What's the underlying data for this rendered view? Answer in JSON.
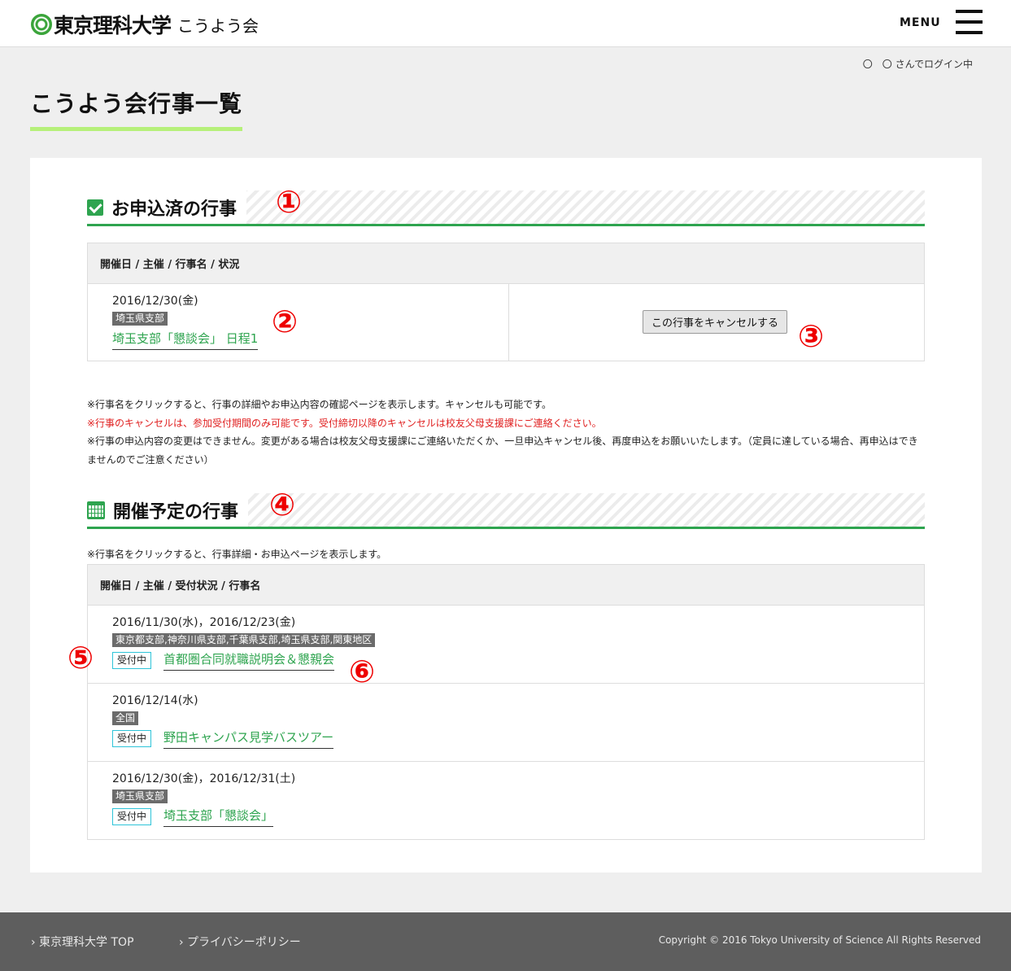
{
  "header": {
    "logo_main": "東京理科大学",
    "logo_sub": "こうよう会",
    "menu_label": "MENU"
  },
  "login_status": "〇　〇 さんでログイン中",
  "page_title": "こうよう会行事一覧",
  "applied": {
    "title": "お申込済の行事",
    "callout": "①",
    "table_header": "開催日 / 主催 / 行事名 / 状況",
    "rows": [
      {
        "date": "2016/12/30(金)",
        "branch": "埼玉県支部",
        "event": "埼玉支部「懇談会」 日程1",
        "cancel_label": "この行事をキャンセルする",
        "callout_event": "②",
        "callout_cancel": "③"
      }
    ]
  },
  "notes": {
    "line1": "※行事名をクリックすると、行事の詳細やお申込内容の確認ページを表示します。キャンセルも可能です。",
    "line2": "※行事のキャンセルは、参加受付期間のみ可能です。受付締切以降のキャンセルは校友父母支援課にご連絡ください。",
    "line3": "※行事の申込内容の変更はできません。変更がある場合は校友父母支援課にご連絡いただくか、一旦申込キャンセル後、再度申込をお願いいたします。（定員に達している場合、再申込はできませんのでご注意ください）"
  },
  "upcoming": {
    "title": "開催予定の行事",
    "callout": "④",
    "note": "※行事名をクリックすると、行事詳細・お申込ページを表示します。",
    "table_header": "開催日 / 主催 / 受付状況 / 行事名",
    "callout_status": "⑤",
    "callout_event": "⑥",
    "rows": [
      {
        "date": "2016/11/30(水)，2016/12/23(金)",
        "branch": "東京都支部,神奈川県支部,千葉県支部,埼玉県支部,関東地区",
        "status": "受付中",
        "event": "首都圏合同就職説明会＆懇親会"
      },
      {
        "date": "2016/12/14(水)",
        "branch": "全国",
        "status": "受付中",
        "event": "野田キャンパス見学バスツアー"
      },
      {
        "date": "2016/12/30(金)，2016/12/31(土)",
        "branch": "埼玉県支部",
        "status": "受付中",
        "event": "埼玉支部「懇談会」"
      }
    ]
  },
  "footer": {
    "link1": "› 東京理科大学 TOP",
    "link2": "› プライバシーポリシー",
    "copyright": "Copyright © 2016 Tokyo University of Science All Rights Reserved"
  },
  "colors": {
    "accent_green": "#2ea44f",
    "title_underline": "#b6f07a",
    "callout_red": "#e00000",
    "status_border": "#2ec4d9",
    "footer_bg": "#5e5e5e"
  }
}
